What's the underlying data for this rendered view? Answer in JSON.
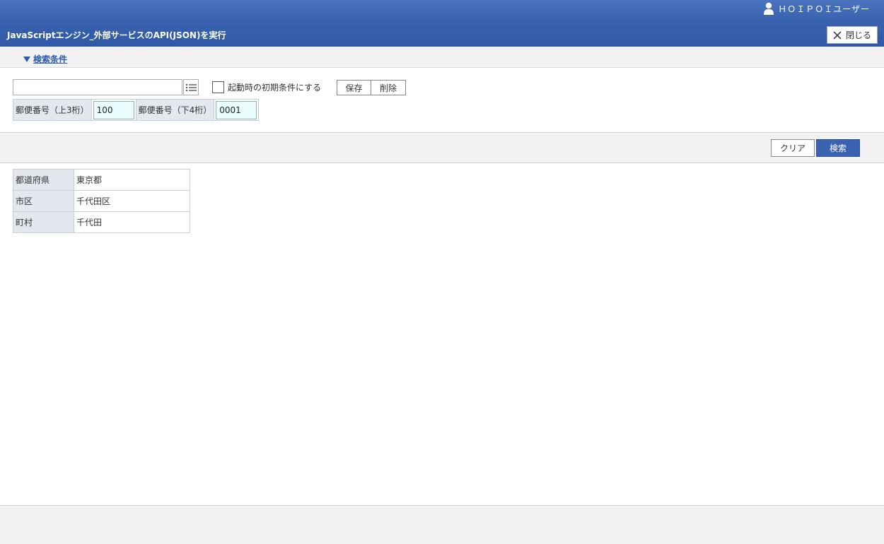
{
  "header": {
    "user_name": "ＨＯＩＰＯＩユーザー",
    "title": "JavaScriptエンジン_外部サービスのAPI(JSON)を実行",
    "close_label": "閉じる"
  },
  "condition": {
    "toggle_label": "検索条件",
    "preset_value": "",
    "default_checkbox_label": "起動時の初期条件にする",
    "default_checked": false,
    "save_label": "保存",
    "delete_label": "削除",
    "zip_upper_label": "郵便番号（上3桁）",
    "zip_upper_value": "100",
    "zip_lower_label": "郵便番号（下4桁）",
    "zip_lower_value": "0001"
  },
  "actions": {
    "clear_label": "クリア",
    "search_label": "検索"
  },
  "result": {
    "rows": [
      {
        "label": "都道府県",
        "value": "東京都"
      },
      {
        "label": "市区",
        "value": "千代田区"
      },
      {
        "label": "町村",
        "value": "千代田"
      }
    ]
  },
  "colors": {
    "header": "#3a63b0",
    "accent": "#2a5aa8",
    "input_highlight": "#e8fbfd"
  }
}
